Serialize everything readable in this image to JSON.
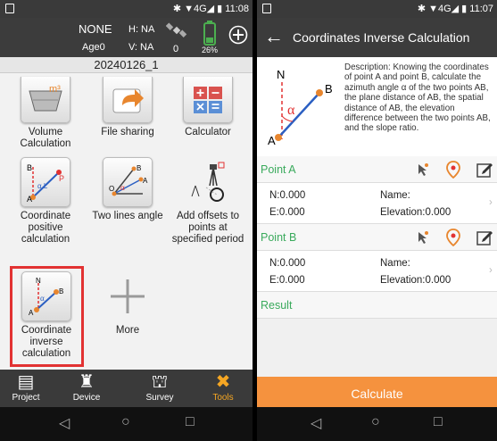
{
  "left": {
    "status": {
      "icons": "✱ ▼4G◢ ▮",
      "time": "11:08"
    },
    "header": {
      "solution": "NONE",
      "h": "H: NA",
      "age": "Age0",
      "v": "V: NA",
      "sats": "0",
      "battery": "26%"
    },
    "project_name": "20240126_1",
    "tools": [
      {
        "label": "Volume Calculation"
      },
      {
        "label": "File sharing"
      },
      {
        "label": "Calculator"
      },
      {
        "label": "Coordinate positive calculation"
      },
      {
        "label": "Two lines angle"
      },
      {
        "label": "Add offsets to points at specified period"
      },
      {
        "label": "Coordinate inverse calculation"
      },
      {
        "label": "More"
      }
    ],
    "bottom_nav": [
      {
        "label": "Project"
      },
      {
        "label": "Device"
      },
      {
        "label": "Survey"
      },
      {
        "label": "Tools"
      }
    ],
    "active_tab_color": "#f5a623"
  },
  "right": {
    "status": {
      "icons": "✱ ▼4G◢ ▮",
      "time": "11:07"
    },
    "title": "Coordinates Inverse Calculation",
    "diagram": {
      "n": "N",
      "b": "B",
      "a": "A",
      "alpha": "α"
    },
    "description": "Description: Knowing the coordinates of point A and point B, calculate the azimuth angle α of the two points AB, the plane distance of AB, the spatial distance of AB, the elevation difference between the two points AB, and the slope ratio.",
    "point_a": {
      "label": "Point A",
      "n": "N:0.000",
      "e": "E:0.000",
      "name": "Name:",
      "elevation": "Elevation:0.000"
    },
    "point_b": {
      "label": "Point B",
      "n": "N:0.000",
      "e": "E:0.000",
      "name": "Name:",
      "elevation": "Elevation:0.000"
    },
    "result_label": "Result",
    "calculate_label": "Calculate",
    "accent": "#f5923e",
    "green": "#3aaa5c"
  }
}
